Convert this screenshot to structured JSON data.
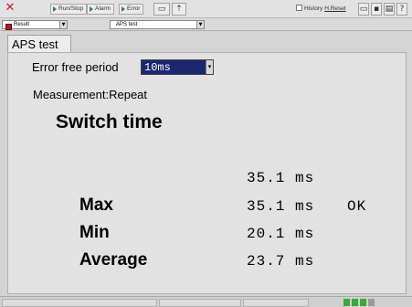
{
  "toolbar": {
    "close_icon": "x-icon",
    "run_stop": "Run/Stop",
    "alarm": "Alarm",
    "error": "Error",
    "history_label": "History",
    "hreset_label": "H.Reset",
    "icons": [
      "window-icon",
      "disk-icon",
      "print-icon",
      "help-icon"
    ]
  },
  "subbar": {
    "view_select": "Result",
    "test_select": "APS test"
  },
  "tab": {
    "label": "APS test"
  },
  "settings": {
    "error_free_label": "Error free period",
    "error_free_value": "10ms"
  },
  "measurement": {
    "mode": "Measurement:Repeat"
  },
  "heading": "Switch time",
  "results": {
    "current": {
      "value": "35.1 ms"
    },
    "rows": [
      {
        "label": "Max",
        "value": "35.1 ms",
        "status": "OK"
      },
      {
        "label": "Min",
        "value": "20.1 ms",
        "status": ""
      },
      {
        "label": "Average",
        "value": "23.7 ms",
        "status": ""
      }
    ]
  },
  "colors": {
    "select_bg": "#1b2670",
    "close": "#c81818",
    "run_arrow": "#2d8a2d",
    "led": "#3aa83a"
  }
}
